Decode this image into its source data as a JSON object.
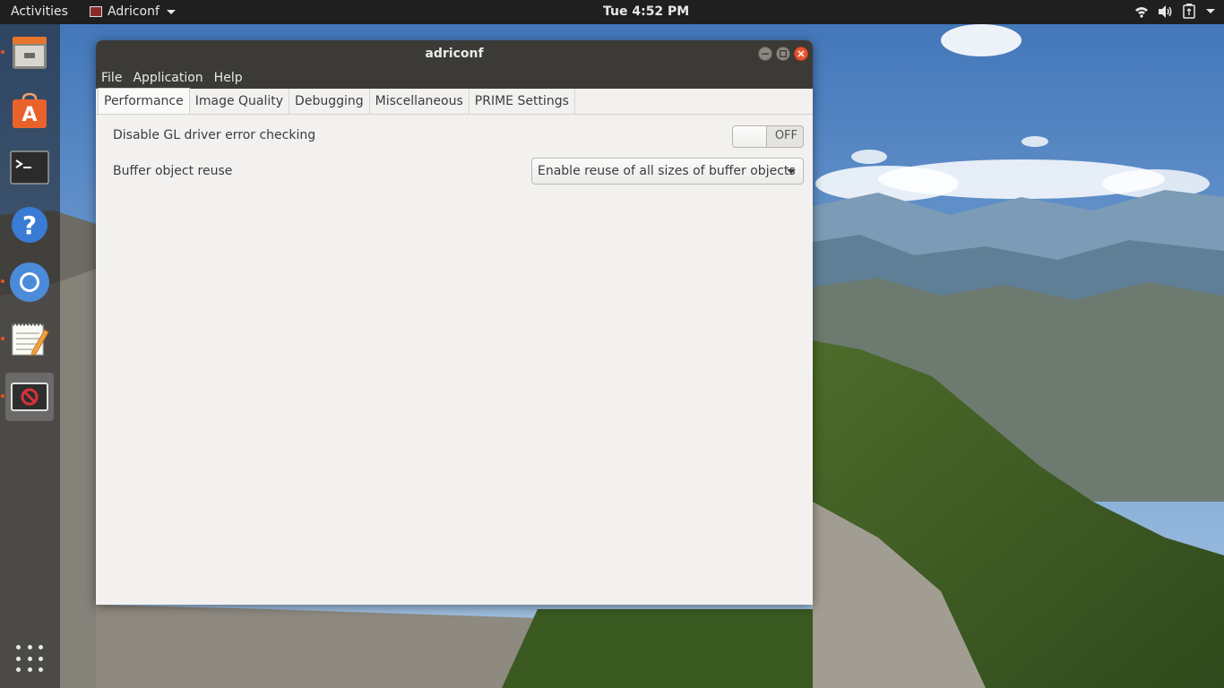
{
  "topbar": {
    "activities": "Activities",
    "app_name": "Adriconf",
    "clock": "Tue  4:52 PM",
    "status_icons": [
      "wifi-icon",
      "volume-icon",
      "battery-icon",
      "chevron-down-icon"
    ]
  },
  "dock": {
    "items": [
      "files-icon",
      "software-center-icon",
      "terminal-icon",
      "help-icon",
      "chromium-icon",
      "text-editor-icon",
      "adriconf-icon"
    ],
    "show_apps": "show-applications-icon"
  },
  "window": {
    "title": "adriconf",
    "menu": [
      "File",
      "Application",
      "Help"
    ],
    "tabs": [
      "Performance",
      "Image Quality",
      "Debugging",
      "Miscellaneous",
      "PRIME Settings"
    ],
    "active_tab": "Performance",
    "settings": {
      "gl_error": {
        "label": "Disable GL driver error checking",
        "state": "OFF"
      },
      "buffer_reuse": {
        "label": "Buffer object reuse",
        "value": "Enable reuse of all sizes of buffer objects"
      }
    }
  },
  "colors": {
    "titlebar": "#3b3a36",
    "window_bg": "#f2f1f0",
    "close_button": "#e9542f",
    "accent_dot": "#e95420"
  }
}
